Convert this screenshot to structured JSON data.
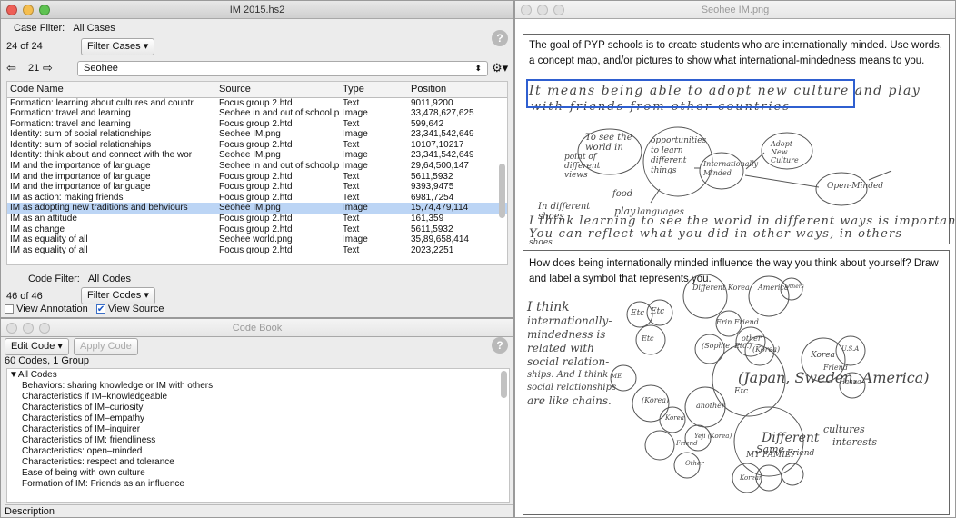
{
  "main_window": {
    "title": "IM 2015.hs2",
    "case_filter_label": "Case Filter:",
    "case_filter_value": "All Cases",
    "case_count": "24  of  24",
    "filter_cases_button": "Filter Cases",
    "nav_number": "21",
    "nav_case": "Seohee",
    "columns": [
      "Code Name",
      "Source",
      "Type",
      "Position"
    ],
    "rows": [
      {
        "code": "Formation: learning about cultures and countr",
        "source": "Focus group 2.htd",
        "type": "Text",
        "position": "9011,9200"
      },
      {
        "code": "Formation: travel and learning",
        "source": "Seohee in and out of school.p",
        "type": "Image",
        "position": "33,478,627,625"
      },
      {
        "code": "Formation: travel and learning",
        "source": "Focus group 2.htd",
        "type": "Text",
        "position": "599,642"
      },
      {
        "code": "Identity: sum of social relationships",
        "source": "Seohee IM.png",
        "type": "Image",
        "position": "23,341,542,649"
      },
      {
        "code": "Identity: sum of social relationships",
        "source": "Focus group 2.htd",
        "type": "Text",
        "position": "10107,10217"
      },
      {
        "code": "Identity: think about and connect with the wor",
        "source": "Seohee IM.png",
        "type": "Image",
        "position": "23,341,542,649"
      },
      {
        "code": "IM and the importance of language",
        "source": "Seohee in and out of school.p",
        "type": "Image",
        "position": "29,64,500,147"
      },
      {
        "code": "IM and the importance of language",
        "source": "Focus group 2.htd",
        "type": "Text",
        "position": "5611,5932"
      },
      {
        "code": "IM and the importance of language",
        "source": "Focus group 2.htd",
        "type": "Text",
        "position": "9393,9475"
      },
      {
        "code": "IM as action: making friends",
        "source": "Focus group 2.htd",
        "type": "Text",
        "position": "6981,7254"
      },
      {
        "code": "IM as adopting new traditions and behviours",
        "source": "Seohee IM.png",
        "type": "Image",
        "position": "15,74,479,114",
        "selected": true
      },
      {
        "code": "IM as an attitude",
        "source": "Focus group 2.htd",
        "type": "Text",
        "position": "161,359"
      },
      {
        "code": "IM as change",
        "source": "Focus group 2.htd",
        "type": "Text",
        "position": "5611,5932"
      },
      {
        "code": "IM as equality of all",
        "source": "Seohee world.png",
        "type": "Image",
        "position": "35,89,658,414"
      },
      {
        "code": "IM as equality of all",
        "source": "Focus group 2.htd",
        "type": "Text",
        "position": "2023,2251"
      }
    ],
    "code_filter_label": "Code Filter:",
    "code_filter_value": "All Codes",
    "code_count": "46  of  46",
    "filter_codes_button": "Filter Codes",
    "view_annotation": "View Annotation",
    "view_source": "View Source"
  },
  "codebook": {
    "title": "Code Book",
    "edit_code": "Edit Code",
    "apply_code": "Apply Code",
    "summary": "60 Codes, 1 Group",
    "group": "All Codes",
    "items": [
      "Behaviors: sharing knowledge or IM with others",
      "Characteristics if IM–knowledgeable",
      "Characteristics of IM–curiosity",
      "Characteristics of IM–empathy",
      "Characteristics of IM–inquirer",
      "Characteristics of IM: friendliness",
      "Characteristics: open–minded",
      "Characteristics: respect and tolerance",
      "Ease of being with own culture",
      "Formation of IM: Friends as an influence"
    ],
    "description_label": "Description"
  },
  "image_window": {
    "title": "Seohee IM.png",
    "prompt1": "The goal of PYP schools is to create students who are internationally minded. Use words, a concept map, and/or pictures to show what international-mindedness means to you.",
    "prompt2": "How does being internationally minded influence the way you think about yourself? Draw and label a symbol that represents you.",
    "hand_line1": "It means being able to adopt new culture and play",
    "hand_line2": "with friends from other countries",
    "hand_line3": "I think learning to see the world in different ways is important",
    "hand_line4": "You can reflect what you did in other ways, in others",
    "hand_line5": "shoes",
    "bubbles": [
      "To see the world in",
      "point of different views",
      "opportunities to learn different things",
      "Internationally Minded",
      "food",
      "play",
      "languages",
      "In different shoes",
      "Adopt New Culture",
      "Open-Minded"
    ],
    "hand2": [
      "I think",
      "internationally-",
      "mindedness is",
      "related with",
      "social relation-",
      "ships. And I think",
      "social relationships",
      "are like chains."
    ],
    "chain": [
      "Etc",
      "Etc",
      "Different Korea",
      "America",
      "Others",
      "Erin Friend",
      "other",
      "(Sophie, Etc.)",
      "Etc",
      "(Korea)",
      "Korea",
      "U.S.A",
      "Hanna",
      "Friend",
      "(Japan, Sweden, America)",
      "Etc",
      "ME",
      "(Korea)",
      "another",
      "Korea",
      "Yeji (Korea)",
      "Different",
      "Same",
      "MY FAMILY",
      "Korean",
      "Other",
      "Friend",
      "Friend",
      "cultures",
      "interests"
    ]
  }
}
